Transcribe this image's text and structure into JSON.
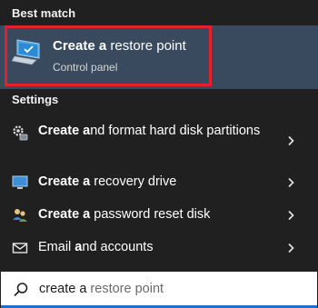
{
  "best_match": {
    "section_label": "Best match",
    "title_bold": "Create a",
    "title_rest": " restore point",
    "subtitle": "Control panel",
    "icon": "restore-point-computer-icon"
  },
  "settings": {
    "section_label": "Settings",
    "items": [
      {
        "bold": "Create a",
        "rest": "nd format hard disk partitions",
        "icon": "gear-disk-icon"
      },
      {
        "bold": "Create a",
        "rest": " recovery drive",
        "icon": "monitor-icon"
      },
      {
        "bold": "Create a",
        "rest": " password reset disk",
        "icon": "users-icon"
      },
      {
        "pre": "Email ",
        "bold": "a",
        "rest": "nd accounts",
        "icon": "mail-icon"
      }
    ]
  },
  "search": {
    "typed": "create a",
    "suggestion": " restore point",
    "icon": "search-icon"
  },
  "colors": {
    "highlight_border": "#e5202a",
    "selected_bg": "#3a4a5e",
    "search_accent": "#1f6fcf"
  }
}
